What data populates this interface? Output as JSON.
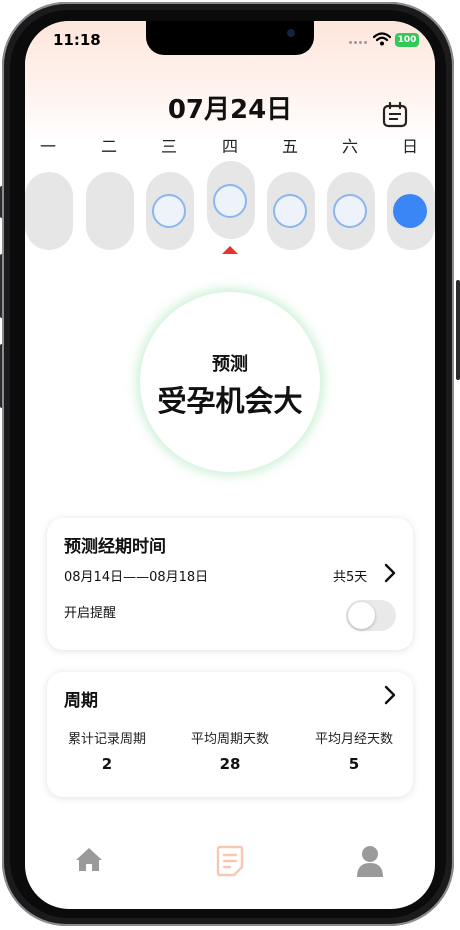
{
  "status": {
    "time": "11:18",
    "battery": "100"
  },
  "header": {
    "date": "07月24日"
  },
  "weekdays": [
    "一",
    "二",
    "三",
    "四",
    "五",
    "六",
    "日"
  ],
  "prediction": {
    "label": "预测",
    "result": "受孕机会大"
  },
  "period_card": {
    "title": "预测经期时间",
    "range": "08月14日——08月18日",
    "total": "共5天",
    "reminder_label": "开启提醒",
    "reminder_on": false
  },
  "cycle_card": {
    "title": "周期",
    "stats": [
      {
        "label": "累计记录周期",
        "value": "2"
      },
      {
        "label": "平均周期天数",
        "value": "28"
      },
      {
        "label": "平均月经天数",
        "value": "5"
      }
    ]
  },
  "tabs": [
    {
      "icon": "home-icon"
    },
    {
      "icon": "document-icon",
      "active": true
    },
    {
      "icon": "person-icon"
    }
  ],
  "colors": {
    "accent": "#3b86f7",
    "ring": "#8bb6ef",
    "indicator": "#e0362f",
    "active_tab": "#f6c8b3",
    "inactive_tab": "#9a9a9a"
  }
}
